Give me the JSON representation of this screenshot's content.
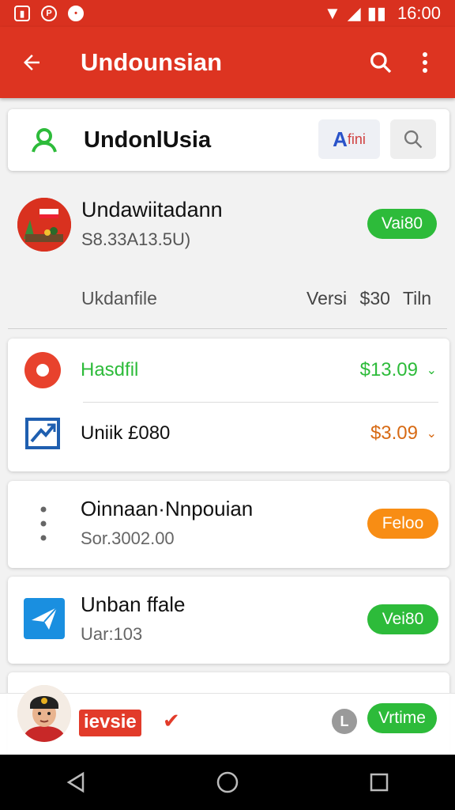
{
  "status_bar": {
    "time": "16:00"
  },
  "app_bar": {
    "title": "Undounsian",
    "back_icon": "arrow-left-icon",
    "search_icon": "search-icon",
    "menu_icon": "more-vert-icon"
  },
  "search": {
    "query": "UndonlUsia",
    "lang_label_first": "A",
    "lang_label_rest": "fini"
  },
  "profile": {
    "name": "Undawiitadann",
    "subtitle": "S8.33A13.5U)",
    "status": "Vai80",
    "file_label": "Ukdanfile",
    "version_label": "Versi",
    "price": "$30",
    "extra": "Tiln"
  },
  "transactions": [
    {
      "label": "Hasdfil",
      "amount": "$13.09",
      "color": "#2dbb3a"
    },
    {
      "label": "Uniik £080",
      "amount": "$3.09",
      "color": "#d76a14"
    }
  ],
  "items": [
    {
      "title": "Oinnaan·Nnpouian",
      "subtitle": "Sor.3002.00",
      "badge": "Feloo",
      "badge_color": "#f88d14"
    },
    {
      "title": "Unban ffale",
      "subtitle": "Uar:103",
      "badge": "Vei80",
      "badge_color": "#2dbb3a"
    }
  ],
  "bottom": {
    "brand": "ievsie",
    "badge": "Vrtime",
    "clock_letter": "L"
  },
  "colors": {
    "accent": "#dd3421",
    "green": "#2dbb3a",
    "orange": "#f88d14"
  }
}
